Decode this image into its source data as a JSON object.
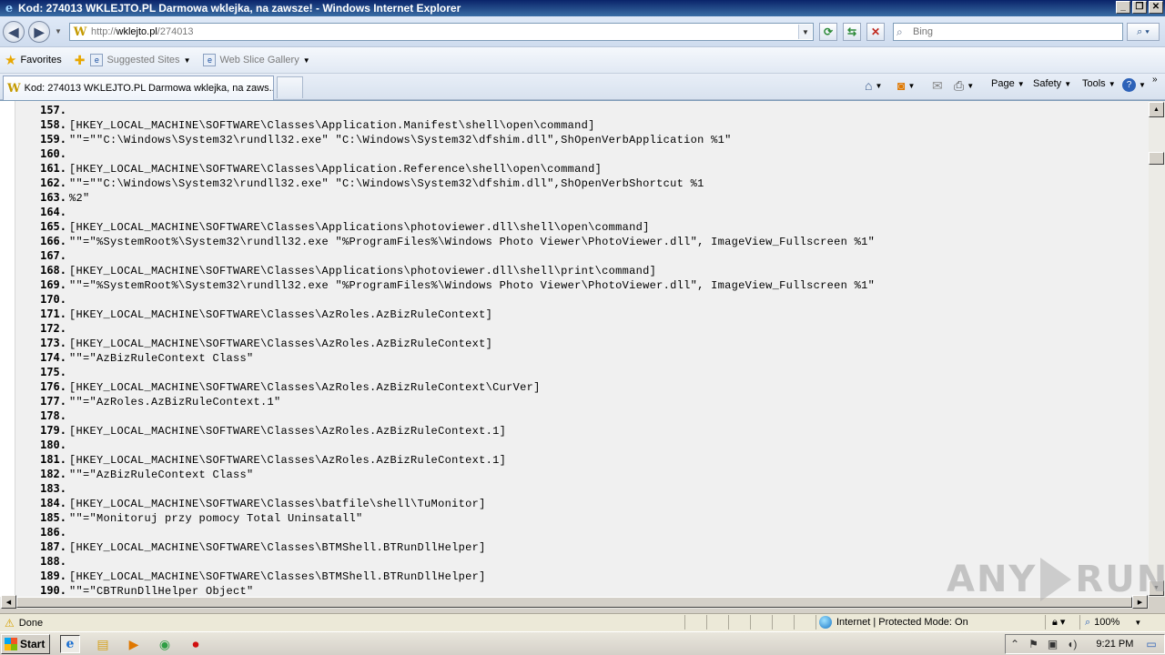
{
  "window": {
    "title": "Kod: 274013 WKLEJTO.PL Darmowa wklejka, na zawsze! - Windows Internet Explorer",
    "min": "_",
    "restore": "❐",
    "close": "✕"
  },
  "nav": {
    "url_proto": "http://",
    "url_host": "wklejto.pl",
    "url_path": "/274013",
    "search_placeholder": "Bing"
  },
  "favorites": {
    "label": "Favorites",
    "items": [
      {
        "label": "Suggested Sites"
      },
      {
        "label": "Web Slice Gallery"
      }
    ]
  },
  "tab": {
    "label": "Kod: 274013 WKLEJTO.PL Darmowa wklejka, na zaws..."
  },
  "commands": {
    "page": "Page",
    "safety": "Safety",
    "tools": "Tools"
  },
  "code": {
    "lines": [
      {
        "n": "157.",
        "t": ""
      },
      {
        "n": "158.",
        "t": "[HKEY_LOCAL_MACHINE\\SOFTWARE\\Classes\\Application.Manifest\\shell\\open\\command]"
      },
      {
        "n": "159.",
        "t": "\"\"=\"\"C:\\Windows\\System32\\rundll32.exe\" \"C:\\Windows\\System32\\dfshim.dll\",ShOpenVerbApplication %1\""
      },
      {
        "n": "160.",
        "t": ""
      },
      {
        "n": "161.",
        "t": "[HKEY_LOCAL_MACHINE\\SOFTWARE\\Classes\\Application.Reference\\shell\\open\\command]"
      },
      {
        "n": "162.",
        "t": "\"\"=\"\"C:\\Windows\\System32\\rundll32.exe\" \"C:\\Windows\\System32\\dfshim.dll\",ShOpenVerbShortcut %1"
      },
      {
        "n": "163.",
        "t": "%2\""
      },
      {
        "n": "164.",
        "t": ""
      },
      {
        "n": "165.",
        "t": "[HKEY_LOCAL_MACHINE\\SOFTWARE\\Classes\\Applications\\photoviewer.dll\\shell\\open\\command]"
      },
      {
        "n": "166.",
        "t": "\"\"=\"%SystemRoot%\\System32\\rundll32.exe \"%ProgramFiles%\\Windows Photo Viewer\\PhotoViewer.dll\", ImageView_Fullscreen %1\""
      },
      {
        "n": "167.",
        "t": ""
      },
      {
        "n": "168.",
        "t": "[HKEY_LOCAL_MACHINE\\SOFTWARE\\Classes\\Applications\\photoviewer.dll\\shell\\print\\command]"
      },
      {
        "n": "169.",
        "t": "\"\"=\"%SystemRoot%\\System32\\rundll32.exe \"%ProgramFiles%\\Windows Photo Viewer\\PhotoViewer.dll\", ImageView_Fullscreen %1\""
      },
      {
        "n": "170.",
        "t": ""
      },
      {
        "n": "171.",
        "t": "[HKEY_LOCAL_MACHINE\\SOFTWARE\\Classes\\AzRoles.AzBizRuleContext]"
      },
      {
        "n": "172.",
        "t": ""
      },
      {
        "n": "173.",
        "t": "[HKEY_LOCAL_MACHINE\\SOFTWARE\\Classes\\AzRoles.AzBizRuleContext]"
      },
      {
        "n": "174.",
        "t": "\"\"=\"AzBizRuleContext Class\""
      },
      {
        "n": "175.",
        "t": ""
      },
      {
        "n": "176.",
        "t": "[HKEY_LOCAL_MACHINE\\SOFTWARE\\Classes\\AzRoles.AzBizRuleContext\\CurVer]"
      },
      {
        "n": "177.",
        "t": "\"\"=\"AzRoles.AzBizRuleContext.1\""
      },
      {
        "n": "178.",
        "t": ""
      },
      {
        "n": "179.",
        "t": "[HKEY_LOCAL_MACHINE\\SOFTWARE\\Classes\\AzRoles.AzBizRuleContext.1]"
      },
      {
        "n": "180.",
        "t": ""
      },
      {
        "n": "181.",
        "t": "[HKEY_LOCAL_MACHINE\\SOFTWARE\\Classes\\AzRoles.AzBizRuleContext.1]"
      },
      {
        "n": "182.",
        "t": "\"\"=\"AzBizRuleContext Class\""
      },
      {
        "n": "183.",
        "t": ""
      },
      {
        "n": "184.",
        "t": "[HKEY_LOCAL_MACHINE\\SOFTWARE\\Classes\\batfile\\shell\\TuMonitor]"
      },
      {
        "n": "185.",
        "t": "\"\"=\"Monitoruj przy pomocy Total Uninsatall\""
      },
      {
        "n": "186.",
        "t": ""
      },
      {
        "n": "187.",
        "t": "[HKEY_LOCAL_MACHINE\\SOFTWARE\\Classes\\BTMShell.BTRunDllHelper]"
      },
      {
        "n": "188.",
        "t": ""
      },
      {
        "n": "189.",
        "t": "[HKEY_LOCAL_MACHINE\\SOFTWARE\\Classes\\BTMShell.BTRunDllHelper]"
      },
      {
        "n": "190.",
        "t": "\"\"=\"CBTRunDllHelper Object\""
      }
    ]
  },
  "watermark": {
    "left": "ANY",
    "right": "RUN"
  },
  "status": {
    "text": "Done",
    "zone": "Internet | Protected Mode: On",
    "zoom": "100%"
  },
  "taskbar": {
    "start": "Start",
    "clock": "9:21 PM"
  }
}
